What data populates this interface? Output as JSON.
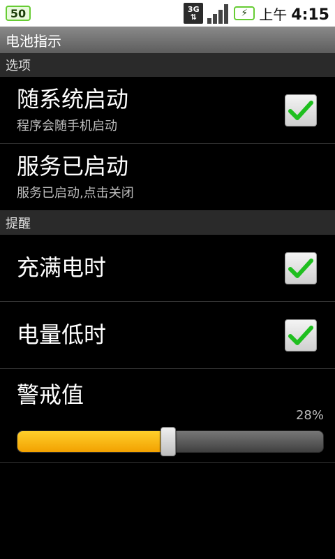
{
  "status_bar": {
    "battery_level": "50",
    "network": "3G",
    "clock_ampm": "上午",
    "clock_time": "4:15",
    "colors": {
      "battery_green": "#66cc33"
    }
  },
  "app": {
    "title": "电池指示"
  },
  "sections": {
    "options": {
      "header": "选项",
      "start_with_system": {
        "title": "随系统启动",
        "summary": "程序会随手机启动",
        "checked": true
      },
      "service_started": {
        "title": "服务已启动",
        "summary": "服务已启动,点击关闭"
      }
    },
    "reminder": {
      "header": "提醒",
      "when_full": {
        "title": "充满电时",
        "checked": true
      },
      "when_low": {
        "title": "电量低时",
        "checked": true
      },
      "threshold": {
        "title": "警戒值",
        "value_text": "28%",
        "value": 0.28
      }
    }
  },
  "icons": {
    "checkbox": "checkmark-icon",
    "signal": "signal-strength-icon",
    "charging": "battery-charging-icon",
    "data": "3g-data-icon"
  }
}
